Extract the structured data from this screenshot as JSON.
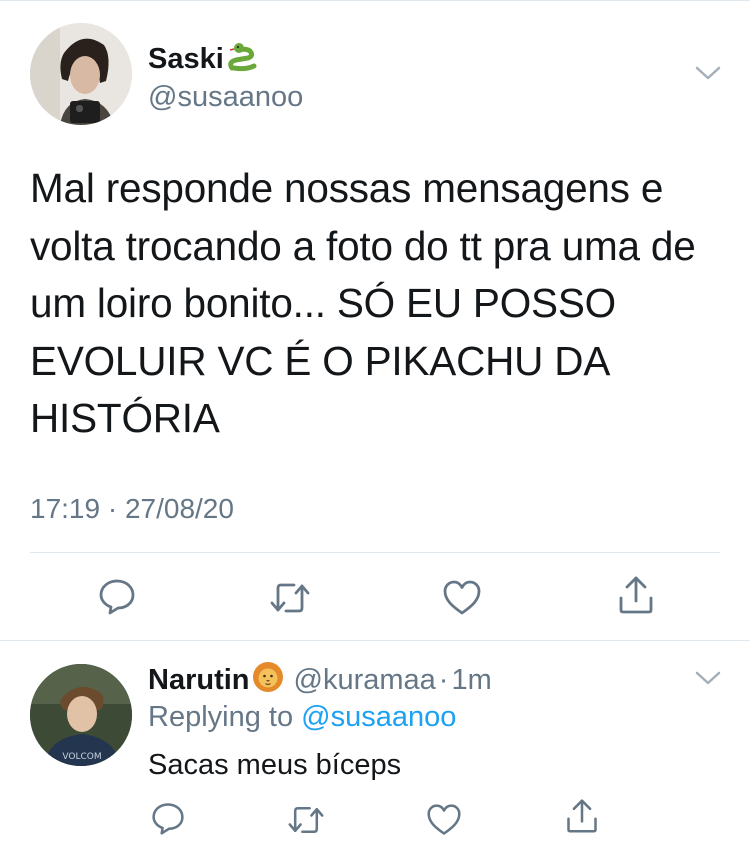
{
  "main_tweet": {
    "display_name": "Saski",
    "name_emoji": "snake-emoji",
    "handle": "@susaanoo",
    "text": "Mal responde nossas mensagens e\nvolta trocando a foto do tt pra uma de\num loiro bonito... SÓ EU POSSO\nEVOLUIR VC É O PIKACHU DA\nHISTÓRIA",
    "timestamp": "17:19 · 27/08/20"
  },
  "reply_tweet": {
    "display_name": "Narutin",
    "name_emoji": "lion-emoji",
    "handle": "@kuramaa",
    "separator": "·",
    "age": "1m",
    "replying_prefix": "Replying to",
    "replying_to": "@susaanoo",
    "text": "Sacas meus bíceps",
    "avatar_shirt_text": "VOLCOM"
  },
  "actions": [
    "reply-icon",
    "retweet-icon",
    "like-icon",
    "share-icon"
  ],
  "colors": {
    "text": "#14171a",
    "secondary": "#657786",
    "link": "#1da1f2",
    "divider": "#e1e8ed"
  }
}
